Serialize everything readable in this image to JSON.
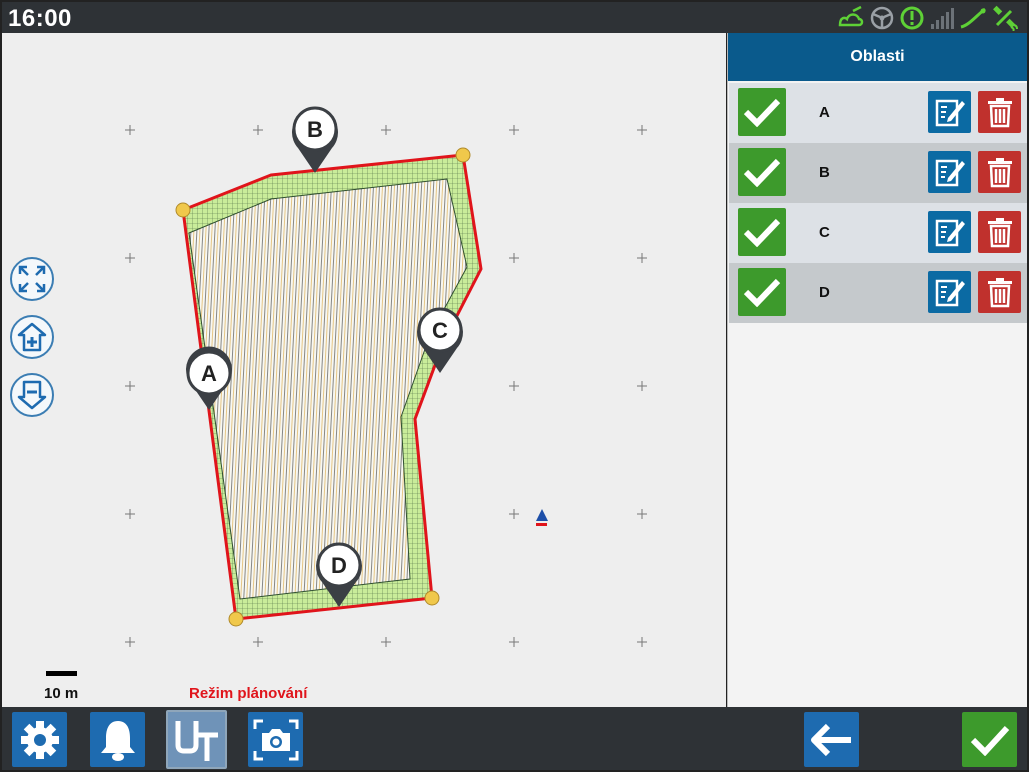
{
  "status_bar": {
    "time": "16:00",
    "icons": [
      "field-boundary-icon",
      "steering-wheel-icon",
      "gnss-warning-icon",
      "signal-strength-icon",
      "guidance-line-icon",
      "satellite-icon"
    ]
  },
  "map": {
    "markers": [
      "A",
      "B",
      "C",
      "D"
    ],
    "scale_label": "10 m",
    "mode_label": "Režim plánování",
    "controls": [
      "fit-view-icon",
      "zoom-in-icon",
      "zoom-out-icon"
    ],
    "colors": {
      "boundary": "#e0141b",
      "headland": "#c9ec9a",
      "vertex": "#f0c84b"
    }
  },
  "panel": {
    "title": "Oblasti",
    "rows": [
      {
        "label": "A"
      },
      {
        "label": "B"
      },
      {
        "label": "C"
      },
      {
        "label": "D"
      }
    ]
  },
  "bottom_bar": {
    "left_buttons": [
      "settings-icon",
      "notifications-icon",
      "ut-icon",
      "screenshot-icon"
    ],
    "right_buttons": [
      "back-arrow-icon",
      "confirm-check-icon"
    ]
  }
}
